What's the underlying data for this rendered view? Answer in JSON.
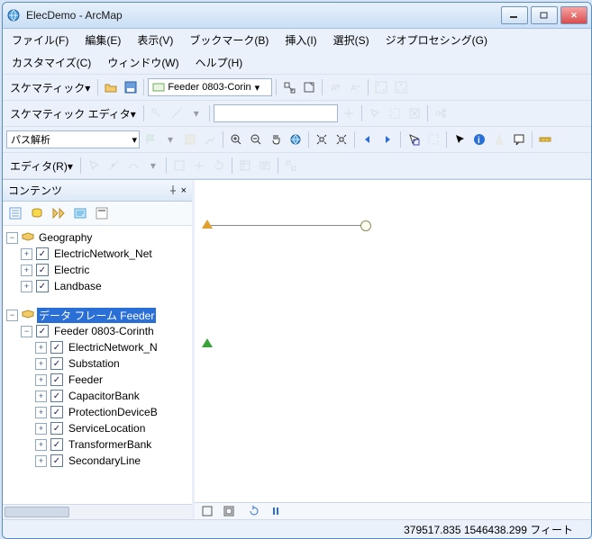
{
  "window": {
    "title": "ElecDemo - ArcMap"
  },
  "menubar": {
    "row1": [
      "ファイル(F)",
      "編集(E)",
      "表示(V)",
      "ブックマーク(B)",
      "挿入(I)",
      "選択(S)",
      "ジオプロセシング(G)"
    ],
    "row2": [
      "カスタマイズ(C)",
      "ウィンドウ(W)",
      "ヘルプ(H)"
    ]
  },
  "toolbar_schematics": {
    "label": "スケマティック",
    "feeder_dd": "Feeder 0803-Corin"
  },
  "toolbar_editor": {
    "label": "スケマティック エディタ"
  },
  "toolbar_path": {
    "dd": "パス解析"
  },
  "toolbar_edit": {
    "label": "エディタ(R)"
  },
  "toc": {
    "title": "コンテンツ",
    "nodes": {
      "geo": "Geography",
      "geo_net": "ElectricNetwork_Net",
      "geo_elec": "Electric",
      "geo_land": "Landbase",
      "df": "データ フレーム Feeder",
      "df_feeder": "Feeder 0803-Corinth",
      "df_enet": "ElectricNetwork_N",
      "df_sub": "Substation",
      "df_fd": "Feeder",
      "df_cap": "CapacitorBank",
      "df_prot": "ProtectionDeviceB",
      "df_svc": "ServiceLocation",
      "df_trans": "TransformerBank",
      "df_sec": "SecondaryLine"
    }
  },
  "status": {
    "coords": "379517.835  1546438.299 フィート"
  }
}
